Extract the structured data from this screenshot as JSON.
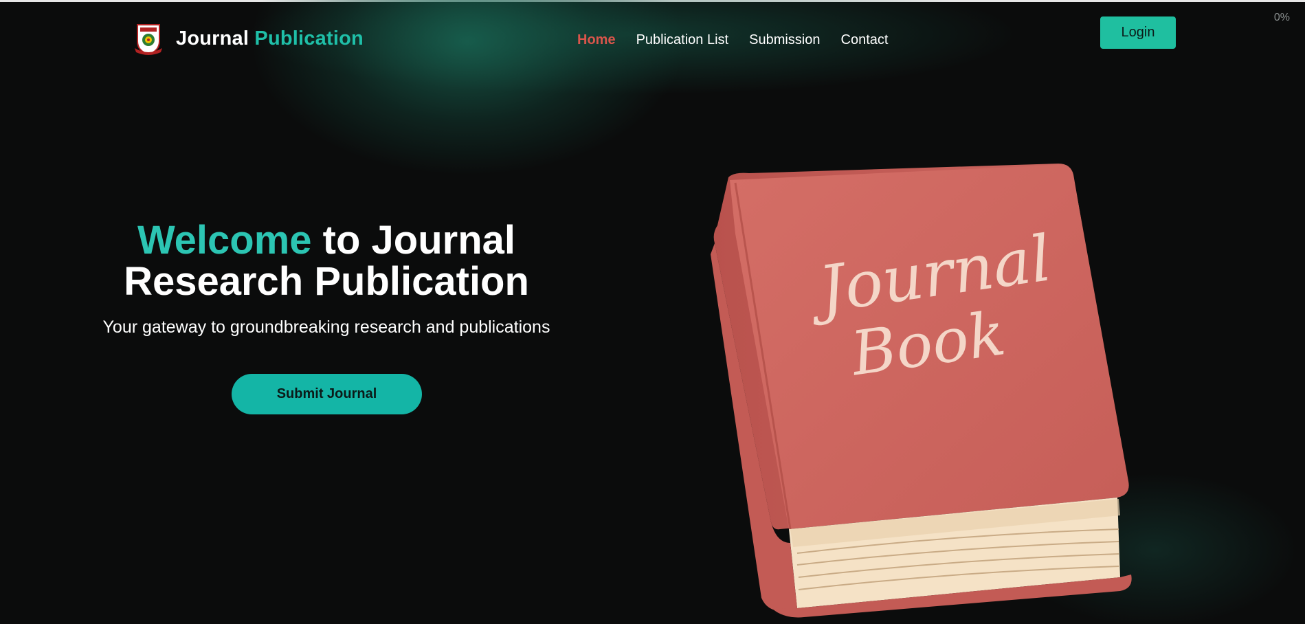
{
  "brand": {
    "name_part1": "Journal",
    "name_part2": "Publication",
    "logo_icon": "university-crest-icon"
  },
  "nav": {
    "items": [
      {
        "label": "Home",
        "active": true
      },
      {
        "label": "Publication List",
        "active": false
      },
      {
        "label": "Submission",
        "active": false
      },
      {
        "label": "Contact",
        "active": false
      }
    ]
  },
  "header": {
    "login_label": "Login",
    "progress_text": "0%"
  },
  "hero": {
    "title_accent": "Welcome",
    "title_rest_line1": " to Journal",
    "title_line2": "Research Publication",
    "subtitle": "Your gateway to groundbreaking research and publications",
    "cta_label": "Submit Journal"
  },
  "illustration": {
    "icon": "journal-book-illustration",
    "cover_text_line1": "Journal",
    "cover_text_line2": "Book"
  },
  "colors": {
    "background": "#0b0c0c",
    "accent": "#1fbfa8",
    "active_nav": "#d9554b",
    "book_cover": "#cc6660",
    "book_pages": "#f7e4c8"
  }
}
